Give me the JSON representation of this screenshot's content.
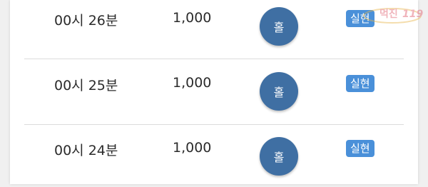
{
  "rows": [
    {
      "time": "00시 26분",
      "amount": "1,000",
      "pick": "홀",
      "status": "실현"
    },
    {
      "time": "00시 25분",
      "amount": "1,000",
      "pick": "홀",
      "status": "실현"
    },
    {
      "time": "00시 24분",
      "amount": "1,000",
      "pick": "홀",
      "status": "실현"
    }
  ],
  "watermark": {
    "text": "먹진",
    "number": "119"
  },
  "colors": {
    "pick_circle": "#3f6fa3",
    "status_badge": "#4a90d9",
    "divider": "#dcdcdc"
  },
  "icons": {
    "pick": "circle-badge",
    "status": "label-badge"
  }
}
